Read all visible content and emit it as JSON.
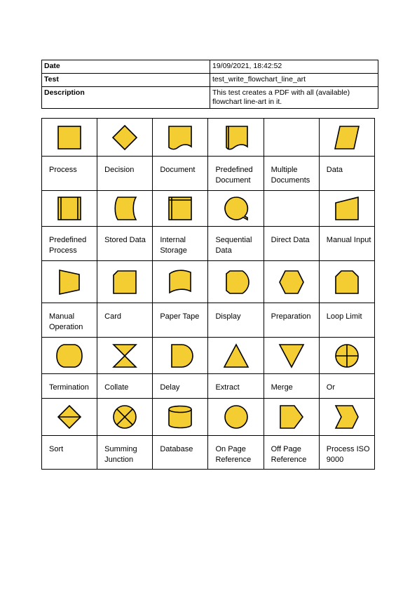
{
  "info": {
    "date_label": "Date",
    "date_value": "19/09/2021, 18:42:52",
    "test_label": "Test",
    "test_value": "test_write_flowchart_line_art",
    "description_label": "Description",
    "description_value": "This test creates a PDF with all (available) flowchart line-art in it."
  },
  "shapes": [
    {
      "label": "Process",
      "icon": "process-icon"
    },
    {
      "label": "Decision",
      "icon": "decision-icon"
    },
    {
      "label": "Document",
      "icon": "document-icon"
    },
    {
      "label": "Predefined Document",
      "icon": "predefined-document-icon"
    },
    {
      "label": "Multiple Documents",
      "icon": "multiple-documents-icon"
    },
    {
      "label": "Data",
      "icon": "data-icon"
    },
    {
      "label": "Predefined Process",
      "icon": "predefined-process-icon"
    },
    {
      "label": "Stored Data",
      "icon": "stored-data-icon"
    },
    {
      "label": "Internal Storage",
      "icon": "internal-storage-icon"
    },
    {
      "label": "Sequential Data",
      "icon": "sequential-data-icon"
    },
    {
      "label": "Direct Data",
      "icon": "direct-data-icon"
    },
    {
      "label": "Manual Input",
      "icon": "manual-input-icon"
    },
    {
      "label": "Manual Operation",
      "icon": "manual-operation-icon"
    },
    {
      "label": "Card",
      "icon": "card-icon"
    },
    {
      "label": "Paper Tape",
      "icon": "paper-tape-icon"
    },
    {
      "label": "Display",
      "icon": "display-icon"
    },
    {
      "label": "Preparation",
      "icon": "preparation-icon"
    },
    {
      "label": "Loop Limit",
      "icon": "loop-limit-icon"
    },
    {
      "label": "Termination",
      "icon": "termination-icon"
    },
    {
      "label": "Collate",
      "icon": "collate-icon"
    },
    {
      "label": "Delay",
      "icon": "delay-icon"
    },
    {
      "label": "Extract",
      "icon": "extract-icon"
    },
    {
      "label": "Merge",
      "icon": "merge-icon"
    },
    {
      "label": "Or",
      "icon": "or-icon"
    },
    {
      "label": "Sort",
      "icon": "sort-icon"
    },
    {
      "label": "Summing Junction",
      "icon": "summing-junction-icon"
    },
    {
      "label": "Database",
      "icon": "database-icon"
    },
    {
      "label": "On Page Reference",
      "icon": "on-page-reference-icon"
    },
    {
      "label": "Off Page Reference",
      "icon": "off-page-reference-icon"
    },
    {
      "label": "Process ISO 9000",
      "icon": "process-iso-9000-icon"
    }
  ],
  "colors": {
    "fill": "#f4cd33",
    "stroke": "#000000"
  }
}
